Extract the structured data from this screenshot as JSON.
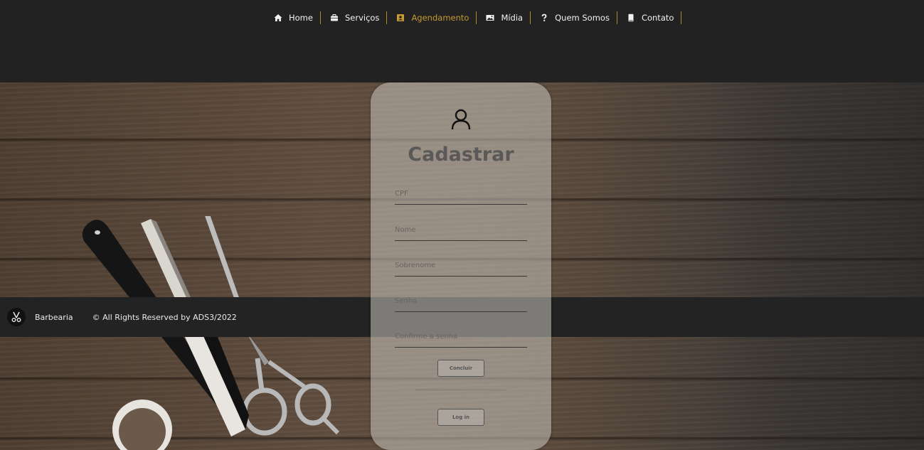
{
  "nav": {
    "items": [
      {
        "label": "Home",
        "icon": "home-icon"
      },
      {
        "label": "Serviços",
        "icon": "briefcase-icon"
      },
      {
        "label": "Agendamento",
        "icon": "contact-card-icon",
        "active": true
      },
      {
        "label": "Mídia",
        "icon": "image-icon"
      },
      {
        "label": "Quem Somos",
        "icon": "question-icon"
      },
      {
        "label": "Contato",
        "icon": "book-icon"
      }
    ]
  },
  "form": {
    "title": "Cadastrar",
    "fields": {
      "cpf": {
        "placeholder": "CPF",
        "value": ""
      },
      "nome": {
        "placeholder": "Nome",
        "value": ""
      },
      "sobrenome": {
        "placeholder": "Sobrenome",
        "value": ""
      },
      "senha": {
        "placeholder": "Senha",
        "value": ""
      },
      "confirmar": {
        "placeholder": "Confirme a senha",
        "value": ""
      }
    },
    "submit_label": "Concluir",
    "login_label": "Log in"
  },
  "footer": {
    "brand": "Barbearia",
    "copyright": "© All Rights Reserved by ADS3/2022"
  },
  "colors": {
    "accent": "#c59a31",
    "topbar": "#222222",
    "footer": "#232323",
    "nav_divider": "#b08a2c"
  }
}
